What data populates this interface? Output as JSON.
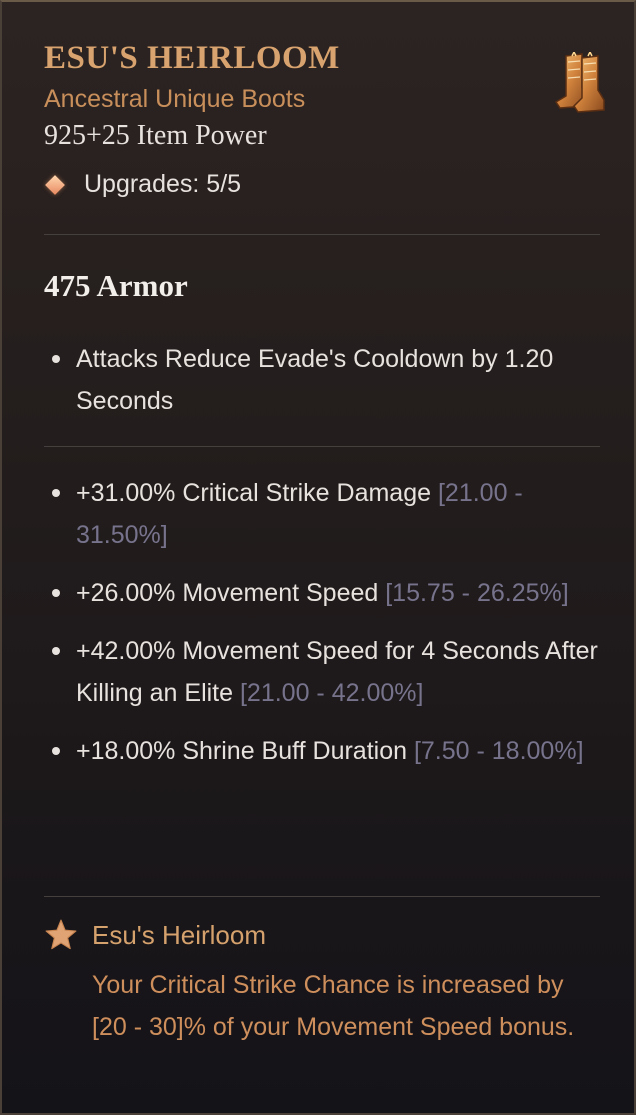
{
  "item": {
    "name": "ESU'S HEIRLOOM",
    "type": "Ancestral Unique Boots",
    "power": "925+25 Item Power",
    "upgrades": "Upgrades: 5/5",
    "icon": "boots-icon",
    "armor": "475 Armor"
  },
  "implicit": [
    {
      "text": "Attacks Reduce Evade's Cooldown by 1.20 Seconds",
      "range": ""
    }
  ],
  "affixes": [
    {
      "text": "+31.00% Critical Strike Damage ",
      "range": "[21.00 - 31.50%]"
    },
    {
      "text": "+26.00% Movement Speed ",
      "range": "[15.75 - 26.25%]"
    },
    {
      "text": "+42.00% Movement Speed for 4 Seconds After Killing an Elite ",
      "range": "[21.00 - 42.00%]"
    },
    {
      "text": "+18.00% Shrine Buff Duration ",
      "range": "[7.50 - 18.00%]"
    }
  ],
  "unique_power": {
    "icon": "star-icon",
    "title": "Esu's Heirloom",
    "description": "Your Critical Strike Chance is increased by [20 - 30]% of your Movement Speed bonus."
  },
  "colors": {
    "name": "#d8a36e",
    "type": "#c98f5b",
    "range": "#77738c",
    "unique_desc": "#cf8f5c"
  }
}
